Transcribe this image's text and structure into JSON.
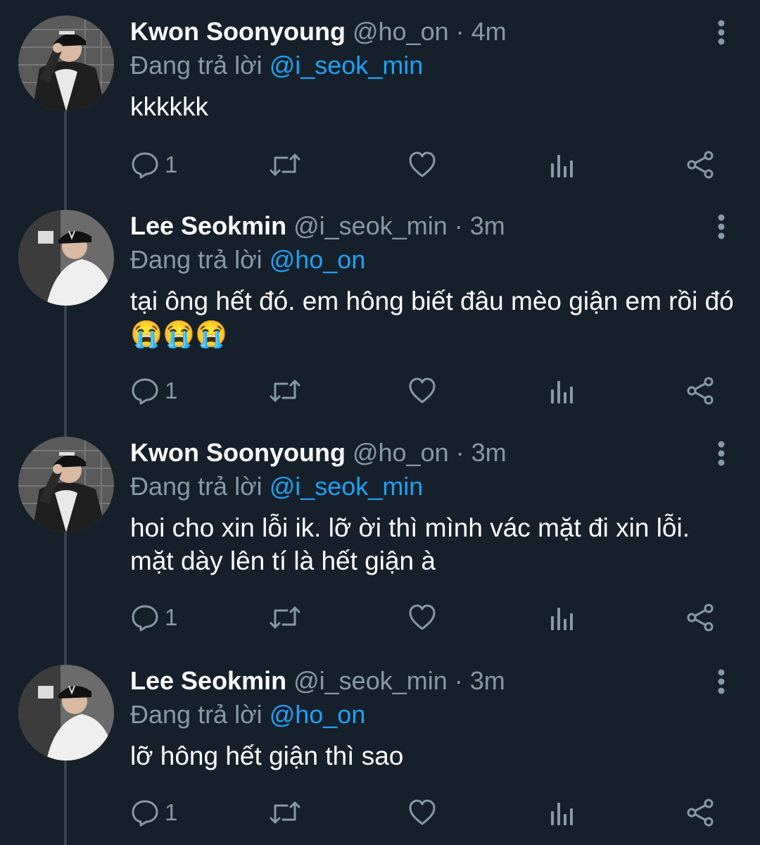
{
  "icons": {
    "reply": "reply-icon",
    "retweet": "retweet-icon",
    "like": "like-icon",
    "analytics": "analytics-icon",
    "share": "share-icon",
    "more": "more-vertical-icon"
  },
  "colors": {
    "background": "#15202b",
    "mention": "#1da1f2",
    "muted": "#8899a6",
    "thread_line": "#38444d"
  },
  "tweets": [
    {
      "name": "Kwon Soonyoung",
      "handle": "@ho_on",
      "separator": "·",
      "time": "4m",
      "replying_prefix": "Đang trả lời ",
      "replying_to": "@i_seok_min",
      "text": "kkkkkk",
      "reply_count": "1"
    },
    {
      "name": "Lee Seokmin",
      "handle": "@i_seok_min",
      "separator": "·",
      "time": "3m",
      "replying_prefix": "Đang trả lời ",
      "replying_to": "@ho_on",
      "text": "tại ông hết đó. em hông biết đâu mèo giận em rồi đó 😭😭😭",
      "reply_count": "1"
    },
    {
      "name": "Kwon Soonyoung",
      "handle": "@ho_on",
      "separator": "·",
      "time": "3m",
      "replying_prefix": "Đang trả lời ",
      "replying_to": "@i_seok_min",
      "text": "hoi cho xin lỗi ik. lỡ ời thì mình vác mặt đi xin lỗi. mặt dày lên tí là hết giận à",
      "reply_count": "1"
    },
    {
      "name": "Lee Seokmin",
      "handle": "@i_seok_min",
      "separator": "·",
      "time": "3m",
      "replying_prefix": "Đang trả lời ",
      "replying_to": "@ho_on",
      "text": "lỡ hông hết giận thì sao",
      "reply_count": "1"
    }
  ]
}
